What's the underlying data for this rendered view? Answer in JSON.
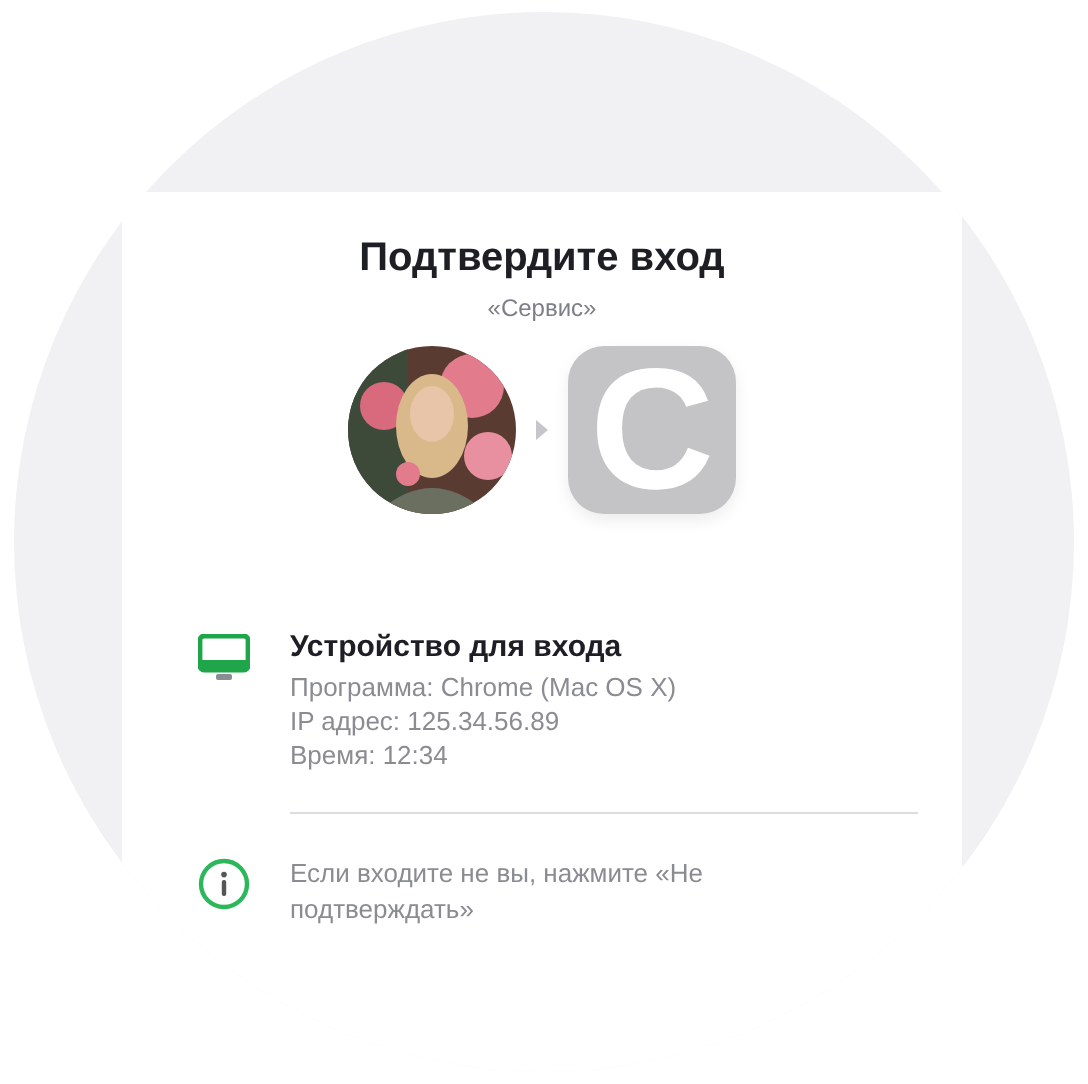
{
  "title": "Подтвердите вход",
  "service": "«Сервис»",
  "app_icon": {
    "letter": "С"
  },
  "device": {
    "heading": "Устройство для входа",
    "details": [
      "Программа: Chrome (Mac OS X)",
      "IP адрес: 125.34.56.89",
      "Время: 12:34"
    ]
  },
  "notice": "Если входите не вы, нажмите «Не подтверждать»"
}
